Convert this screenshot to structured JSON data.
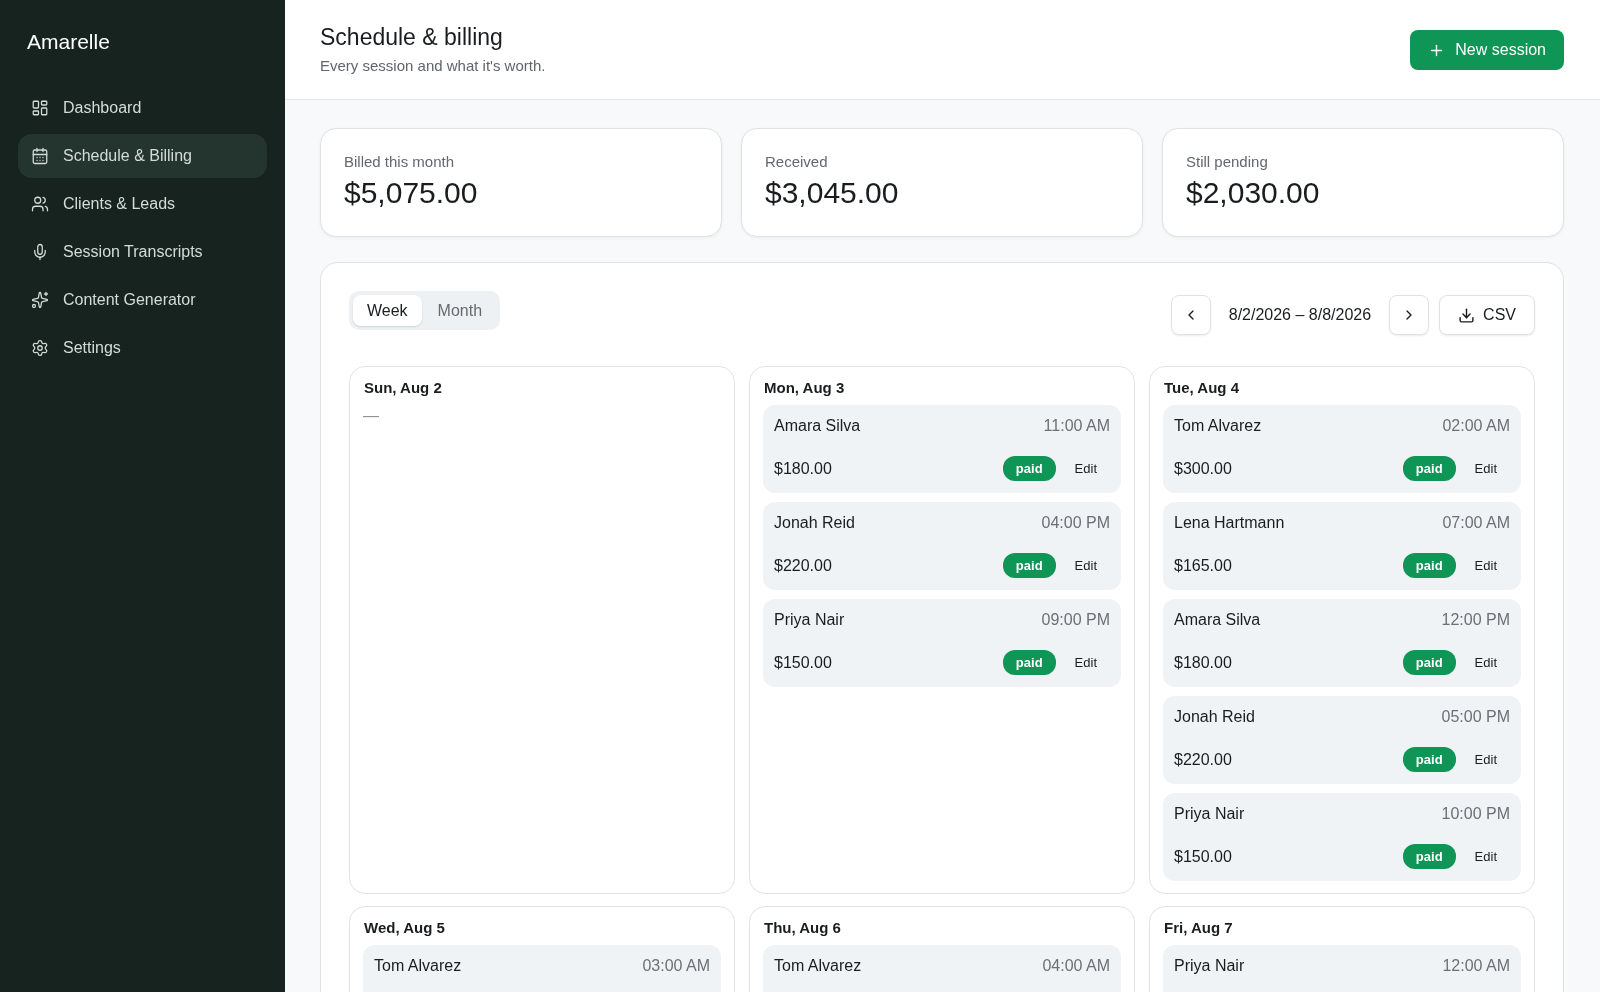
{
  "sidebar": {
    "brand": "Amarelle",
    "items": [
      {
        "label": "Dashboard",
        "selected": false
      },
      {
        "label": "Schedule & Billing",
        "selected": true
      },
      {
        "label": "Clients & Leads",
        "selected": false
      },
      {
        "label": "Session Transcripts",
        "selected": false
      },
      {
        "label": "Content Generator",
        "selected": false
      },
      {
        "label": "Settings",
        "selected": false
      }
    ]
  },
  "header": {
    "title": "Schedule & billing",
    "subtitle": "Every session and what it's worth.",
    "action": "New session"
  },
  "stats": [
    {
      "label": "Billed this month",
      "value": "$5,075.00"
    },
    {
      "label": "Received",
      "value": "$3,045.00"
    },
    {
      "label": "Still pending",
      "value": "$2,030.00"
    }
  ],
  "calendar": {
    "views": [
      {
        "label": "Week",
        "selected": true
      },
      {
        "label": "Month",
        "selected": false
      }
    ],
    "range": "8/2/2026 – 8/8/2026",
    "export": "CSV",
    "days": [
      {
        "title": "Sun, Aug 2",
        "empty": "—"
      },
      {
        "title": "Mon, Aug 3",
        "sessions": [
          {
            "client": "Amara Silva",
            "time": "11:00 AM",
            "amount": "$180.00",
            "status": "paid",
            "action": "Edit"
          },
          {
            "client": "Jonah Reid",
            "time": "04:00 PM",
            "amount": "$220.00",
            "status": "paid",
            "action": "Edit"
          },
          {
            "client": "Priya Nair",
            "time": "09:00 PM",
            "amount": "$150.00",
            "status": "paid",
            "action": "Edit"
          }
        ]
      },
      {
        "title": "Tue, Aug 4",
        "sessions": [
          {
            "client": "Tom Alvarez",
            "time": "02:00 AM",
            "amount": "$300.00",
            "status": "paid",
            "action": "Edit"
          },
          {
            "client": "Lena Hartmann",
            "time": "07:00 AM",
            "amount": "$165.00",
            "status": "paid",
            "action": "Edit"
          },
          {
            "client": "Amara Silva",
            "time": "12:00 PM",
            "amount": "$180.00",
            "status": "paid",
            "action": "Edit"
          },
          {
            "client": "Jonah Reid",
            "time": "05:00 PM",
            "amount": "$220.00",
            "status": "paid",
            "action": "Edit"
          },
          {
            "client": "Priya Nair",
            "time": "10:00 PM",
            "amount": "$150.00",
            "status": "paid",
            "action": "Edit"
          }
        ]
      },
      {
        "title": "Wed, Aug 5",
        "sessions": [
          {
            "client": "Tom Alvarez",
            "time": "03:00 AM"
          }
        ]
      },
      {
        "title": "Thu, Aug 6",
        "sessions": [
          {
            "client": "Tom Alvarez",
            "time": "04:00 AM"
          }
        ]
      },
      {
        "title": "Fri, Aug 7",
        "sessions": [
          {
            "client": "Priya Nair",
            "time": "12:00 AM"
          }
        ]
      }
    ]
  }
}
